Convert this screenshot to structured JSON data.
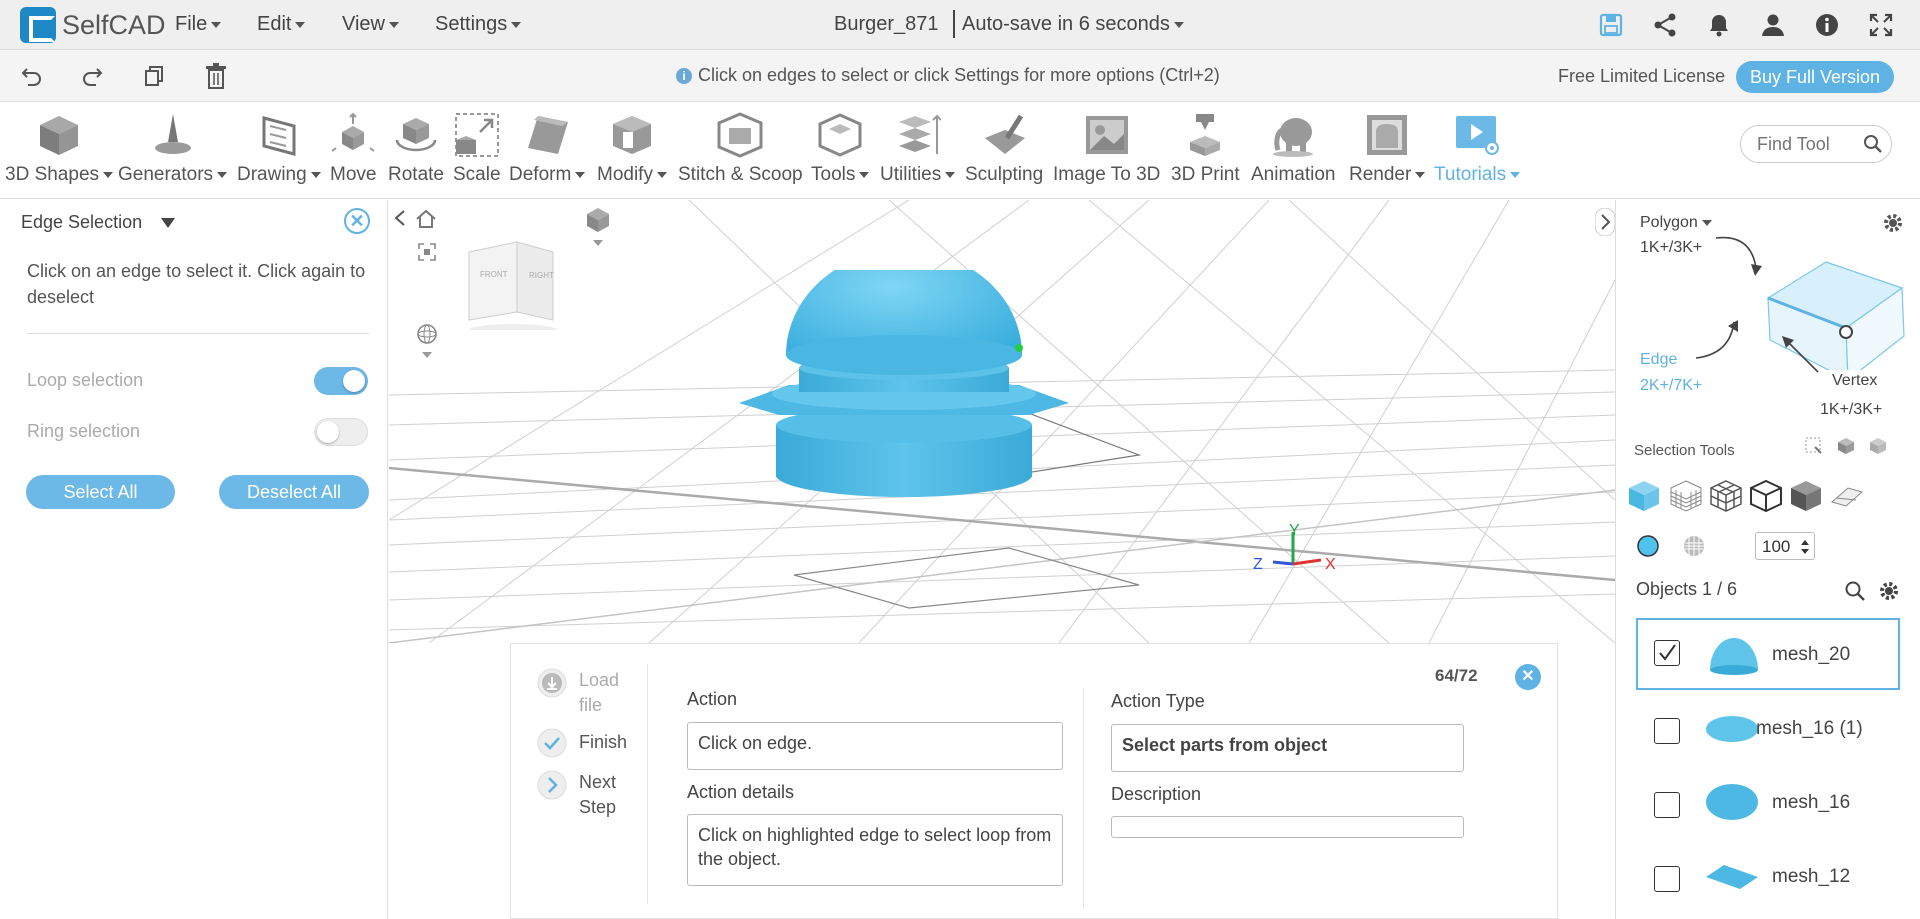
{
  "app": {
    "name": "SelfCAD"
  },
  "menu": {
    "file": "File",
    "edit": "Edit",
    "view": "View",
    "settings": "Settings"
  },
  "document": {
    "title": "Burger_871",
    "autosave": "Auto-save in 6 seconds"
  },
  "actionbar": {
    "hint": "Click on edges to select or click Settings for more options (Ctrl+2)",
    "license": "Free Limited License",
    "buy": "Buy Full Version"
  },
  "toolbar": {
    "items": [
      {
        "label": "3D Shapes"
      },
      {
        "label": "Generators"
      },
      {
        "label": "Drawing"
      },
      {
        "label": "Move"
      },
      {
        "label": "Rotate"
      },
      {
        "label": "Scale"
      },
      {
        "label": "Deform"
      },
      {
        "label": "Modify"
      },
      {
        "label": "Stitch & Scoop"
      },
      {
        "label": "Tools"
      },
      {
        "label": "Utilities"
      },
      {
        "label": "Sculpting"
      },
      {
        "label": "Image To 3D"
      },
      {
        "label": "3D Print"
      },
      {
        "label": "Animation"
      },
      {
        "label": "Render"
      },
      {
        "label": "Tutorials"
      }
    ],
    "find_placeholder": "Find Tool"
  },
  "left_panel": {
    "title": "Edge Selection",
    "description": "Click on an edge to select it. Click again to deselect",
    "loop_label": "Loop selection",
    "loop_on": true,
    "ring_label": "Ring selection",
    "ring_on": false,
    "select_all": "Select All",
    "deselect_all": "Deselect All"
  },
  "viewcube": {
    "front": "FRONT",
    "right": "RIGHT"
  },
  "axes": {
    "x": "X",
    "y": "Y",
    "z": "Z"
  },
  "tutorial": {
    "steps": [
      {
        "label": "Load file"
      },
      {
        "label": "Finish"
      },
      {
        "label": "Next Step"
      }
    ],
    "progress": "64/72",
    "action_label": "Action",
    "action_value": "Click on edge.",
    "action_details_label": "Action details",
    "action_details_value": "Click on highlighted edge to select loop from the object.",
    "action_type_label": "Action Type",
    "action_type_value": "Select parts from object",
    "description_label": "Description",
    "description_value": ""
  },
  "right_panel": {
    "polygon_label": "Polygon",
    "polygon_count": "1K+/3K+",
    "edge_label": "Edge",
    "edge_count": "2K+/7K+",
    "vertex_label": "Vertex",
    "vertex_count": "1K+/3K+",
    "selection_tools": "Selection Tools",
    "size_value": "100",
    "objects_label": "Objects 1 / 6",
    "objects": [
      {
        "name": "mesh_20",
        "checked": true
      },
      {
        "name": "mesh_16 (1)",
        "checked": false
      },
      {
        "name": "mesh_16",
        "checked": false
      },
      {
        "name": "mesh_12",
        "checked": false
      }
    ]
  },
  "colors": {
    "accent": "#5fb2e4",
    "model": "#5ec4ea"
  }
}
